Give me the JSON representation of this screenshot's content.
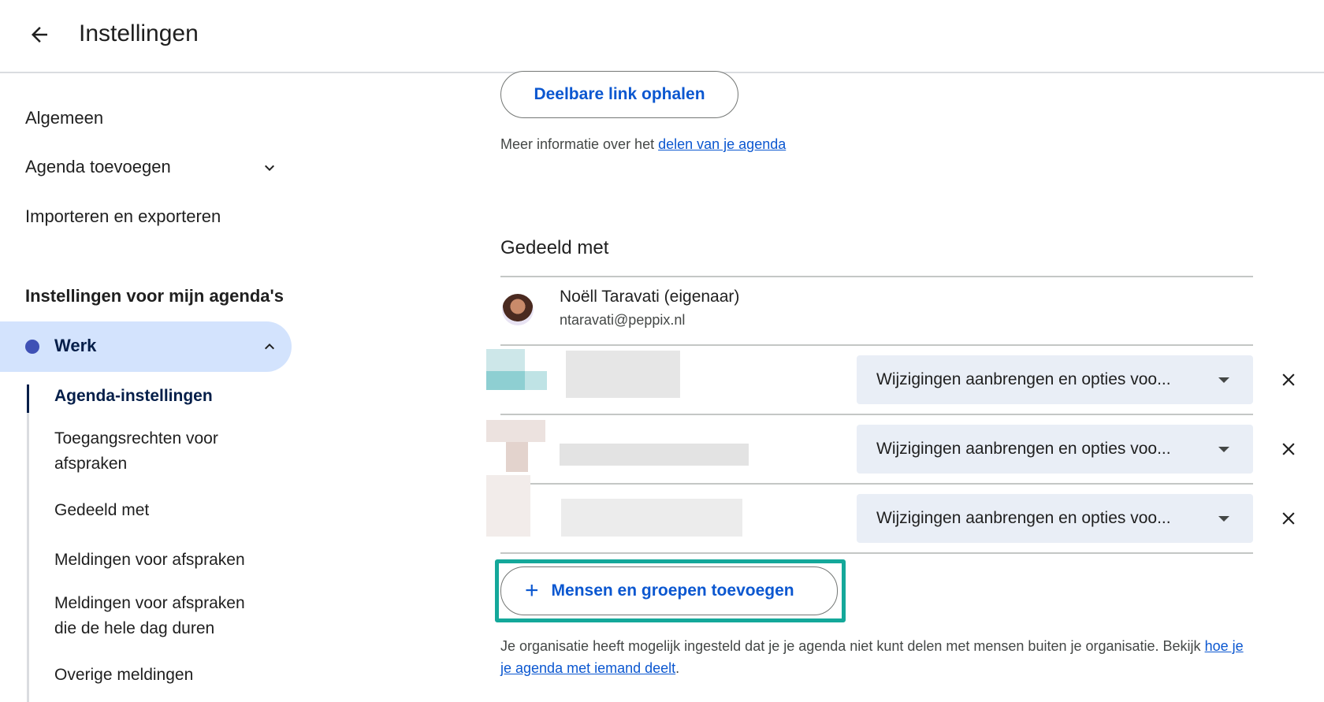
{
  "header": {
    "title": "Instellingen",
    "back_icon": "arrow-left-icon"
  },
  "sidebar": {
    "items": [
      {
        "label": "Algemeen"
      },
      {
        "label": "Agenda toevoegen",
        "icon": "chevron-down-icon"
      },
      {
        "label": "Importeren en exporteren"
      }
    ],
    "section_title": "Instellingen voor mijn agenda's",
    "calendar": {
      "label": "Werk",
      "color": "#3f51b5",
      "icon": "chevron-up-icon"
    },
    "subitems": [
      {
        "label": "Agenda-instellingen",
        "active": true
      },
      {
        "label": "Toegangsrechten voor afspraken"
      },
      {
        "label": "Gedeeld met"
      },
      {
        "label": "Meldingen voor afspraken"
      },
      {
        "label": "Meldingen voor afspraken die de hele dag duren"
      },
      {
        "label": "Overige meldingen"
      }
    ]
  },
  "main": {
    "share_link_button": "Deelbare link ophalen",
    "info_prefix": "Meer informatie over het ",
    "info_link": "delen van je agenda",
    "shared_heading": "Gedeeld met",
    "owner": {
      "name": "Noëll Taravati (eigenaar)",
      "email": "ntaravati@peppix.nl"
    },
    "shared_users": [
      {
        "permission": "Wijzigingen aanbrengen en opties voo..."
      },
      {
        "permission": "Wijzigingen aanbrengen en opties voo..."
      },
      {
        "permission": "Wijzigingen aanbrengen en opties voo..."
      }
    ],
    "add_button": "Mensen en groepen toevoegen",
    "add_icon": "plus-icon",
    "remove_icon": "close-icon",
    "highlight_color": "#14a89a",
    "org_note_text": "Je organisatie heeft mogelijk ingesteld dat je je agenda niet kunt delen met mensen buiten je organisatie. Bekijk ",
    "org_note_link": "hoe je je agenda met iemand deelt",
    "org_note_end": "."
  },
  "colors": {
    "accent": "#0b57d0",
    "active_bg": "#d3e3fd",
    "select_bg": "#e9eef6"
  }
}
